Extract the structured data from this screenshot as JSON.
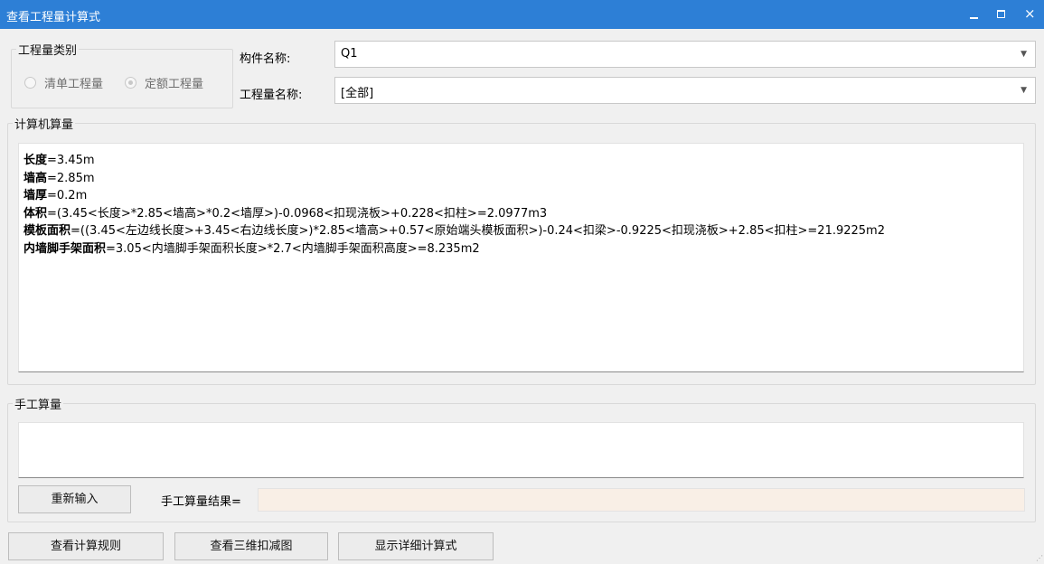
{
  "window": {
    "title": "查看工程量计算式",
    "minimize_glyph": "minimize-icon",
    "maximize_glyph": "maximize-icon",
    "close_glyph": "×"
  },
  "category": {
    "legend": "工程量类别",
    "options": [
      {
        "label": "清单工程量",
        "checked": false
      },
      {
        "label": "定额工程量",
        "checked": true
      }
    ]
  },
  "component": {
    "label": "构件名称:",
    "value": "Q1"
  },
  "quantity": {
    "label": "工程量名称:",
    "value": "[全部]"
  },
  "computer_calc": {
    "legend": "计算机算量",
    "lines": [
      {
        "name": "长度",
        "expr": "=3.45m"
      },
      {
        "name": "墙高",
        "expr": "=2.85m"
      },
      {
        "name": "墙厚",
        "expr": "=0.2m"
      },
      {
        "name": "体积",
        "expr": "=(3.45<长度>*2.85<墙高>*0.2<墙厚>)-0.0968<扣现浇板>+0.228<扣柱>=2.0977m3"
      },
      {
        "name": "模板面积",
        "expr": "=((3.45<左边线长度>+3.45<右边线长度>)*2.85<墙高>+0.57<原始端头模板面积>)-0.24<扣梁>-0.9225<扣现浇板>+2.85<扣柱>=21.9225m2"
      },
      {
        "name": "内墙脚手架面积",
        "expr": "=3.05<内墙脚手架面积长度>*2.7<内墙脚手架面积高度>=8.235m2"
      }
    ]
  },
  "manual_calc": {
    "legend": "手工算量",
    "reenter_label": "重新输入",
    "result_label": "手工算量结果=",
    "result_value": ""
  },
  "buttons": {
    "view_rules": "查看计算规则",
    "view_3d": "查看三维扣减图",
    "show_detail": "显示详细计算式"
  },
  "colors": {
    "titlebar": "#2d7fd6",
    "result_field": "#f9efe6"
  }
}
